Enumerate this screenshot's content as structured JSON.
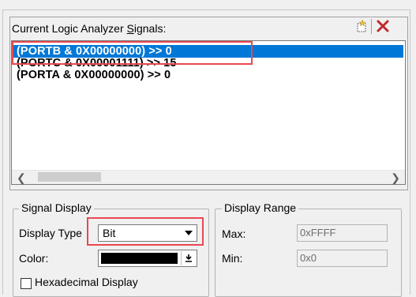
{
  "signals": {
    "label_prefix": "Current Logic Analyzer ",
    "label_underlined": "S",
    "label_suffix": "ignals:",
    "items": [
      {
        "text": "(PORTB & 0X00000000) >> 0",
        "selected": true
      },
      {
        "text": "(PORTC & 0X00001111) >> 15",
        "selected": false
      },
      {
        "text": "(PORTA & 0X00000000) >> 0",
        "selected": false
      }
    ],
    "new_icon": "new-signal-icon",
    "delete_icon": "delete-icon"
  },
  "signal_display": {
    "title": "Signal Display",
    "display_type_label": "Display Type",
    "display_type_value": "Bit",
    "color_label": "Color:",
    "color_value": "#000000",
    "hex_label": "Hexadecimal Display"
  },
  "display_range": {
    "title": "Display Range",
    "max_label": "Max:",
    "max_value": "0xFFFF",
    "min_label": "Min:",
    "min_value": "0x0"
  },
  "colors": {
    "selection": "#0078d7",
    "highlight": "#e84850"
  }
}
